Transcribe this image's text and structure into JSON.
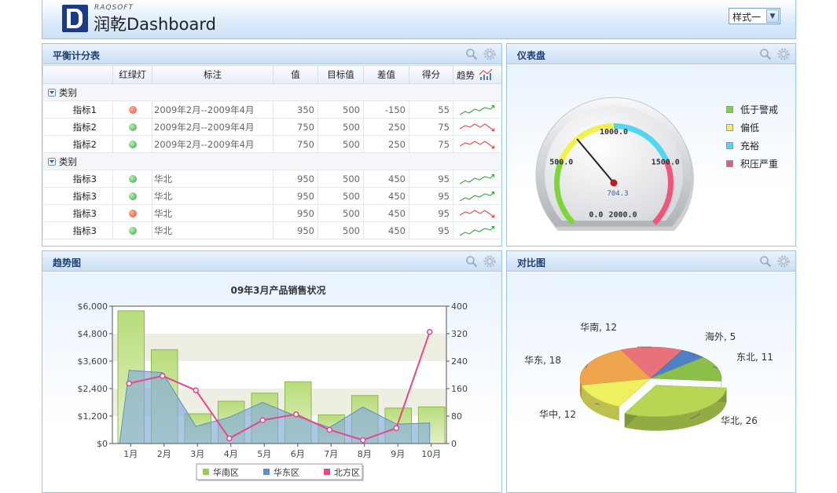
{
  "header": {
    "brand_small": "RAQSOFT",
    "title": "润乾Dashboard",
    "style_select": {
      "value": "样式一"
    }
  },
  "balanced_scorecard": {
    "title": "平衡计分表",
    "columns": [
      "红绿灯",
      "标注",
      "值",
      "目标值",
      "差值",
      "得分",
      "趋势"
    ],
    "groups": [
      {
        "label": "类别",
        "rows": [
          {
            "name": "指标1",
            "light": "red",
            "note": "2009年2月--2009年4月",
            "value": "350",
            "target": "500",
            "diff": "-150",
            "score": "55",
            "trend": "up"
          },
          {
            "name": "指标2",
            "light": "green",
            "note": "2009年2月--2009年4月",
            "value": "750",
            "target": "500",
            "diff": "250",
            "score": "75",
            "trend": "down"
          },
          {
            "name": "指标2",
            "light": "green",
            "note": "2009年2月--2009年4月",
            "value": "750",
            "target": "500",
            "diff": "250",
            "score": "75",
            "trend": "down"
          }
        ]
      },
      {
        "label": "类别",
        "rows": [
          {
            "name": "指标3",
            "light": "green",
            "note": "华北",
            "value": "950",
            "target": "500",
            "diff": "450",
            "score": "95",
            "trend": "up"
          },
          {
            "name": "指标3",
            "light": "green",
            "note": "华北",
            "value": "950",
            "target": "500",
            "diff": "450",
            "score": "95",
            "trend": "up"
          },
          {
            "name": "指标3",
            "light": "red",
            "note": "华北",
            "value": "950",
            "target": "500",
            "diff": "450",
            "score": "95",
            "trend": "down"
          },
          {
            "name": "指标3",
            "light": "green",
            "note": "华北",
            "value": "950",
            "target": "500",
            "diff": "450",
            "score": "95",
            "trend": "up"
          }
        ]
      }
    ]
  },
  "gauge": {
    "title": "仪表盘",
    "min": 0,
    "max": 2000,
    "value": 704.3,
    "value_label": "704.3",
    "tick_labels": [
      "0.0",
      "500.0",
      "1000.0",
      "1500.0",
      "2000.0"
    ],
    "legend": [
      {
        "label": "低于警戒",
        "color": "#7fd43a"
      },
      {
        "label": "偏低",
        "color": "#f2f24a"
      },
      {
        "label": "充裕",
        "color": "#52d6f2"
      },
      {
        "label": "积压严重",
        "color": "#f2557a"
      }
    ],
    "bands": [
      {
        "from": 0,
        "to": 500,
        "color": "#7fd43a"
      },
      {
        "from": 500,
        "to": 1000,
        "color": "#f2f24a"
      },
      {
        "from": 1000,
        "to": 1500,
        "color": "#52d6f2"
      },
      {
        "from": 1500,
        "to": 2000,
        "color": "#f2557a"
      }
    ]
  },
  "trend_panel": {
    "title": "趋势图"
  },
  "compare_panel": {
    "title": "对比图"
  },
  "chart_data": [
    {
      "type": "bar",
      "title": "09年3月产品销售状况",
      "categories": [
        "1月",
        "2月",
        "3月",
        "4月",
        "5月",
        "6月",
        "7月",
        "8月",
        "9月",
        "10月"
      ],
      "ylim": [
        0,
        6000
      ],
      "y_ticks": [
        "$0",
        "$1,200",
        "$2,400",
        "$3,600",
        "$4,800",
        "$6,000"
      ],
      "y2lim": [
        0,
        400
      ],
      "y2_ticks": [
        "0",
        "80",
        "160",
        "240",
        "320",
        "400"
      ],
      "series": [
        {
          "name": "华南区",
          "kind": "bar",
          "axis": "left",
          "color": "#9cc95a",
          "values": [
            5800,
            4100,
            1300,
            1850,
            2200,
            2700,
            1250,
            2100,
            1550,
            1600
          ]
        },
        {
          "name": "华东区",
          "kind": "area",
          "axis": "left",
          "color": "#7fa9d6",
          "values": [
            3200,
            3100,
            750,
            1150,
            1800,
            1200,
            700,
            1600,
            850,
            900
          ]
        },
        {
          "name": "北方区",
          "kind": "line",
          "axis": "right",
          "color": "#e5478a",
          "values": [
            175,
            197,
            155,
            15,
            68,
            85,
            40,
            10,
            45,
            325
          ]
        }
      ],
      "legend_position": "bottom"
    },
    {
      "type": "pie",
      "slices": [
        {
          "label": "华南",
          "value": 12,
          "color": "#e9727a"
        },
        {
          "label": "海外",
          "value": 5,
          "color": "#4f7fc4"
        },
        {
          "label": "东北",
          "value": 11,
          "color": "#8bbf4a"
        },
        {
          "label": "华北",
          "value": 26,
          "color": "#b7d654"
        },
        {
          "label": "华中",
          "value": 12,
          "color": "#eef060"
        },
        {
          "label": "华东",
          "value": 18,
          "color": "#efa54c"
        }
      ],
      "exploded": "华北"
    }
  ]
}
